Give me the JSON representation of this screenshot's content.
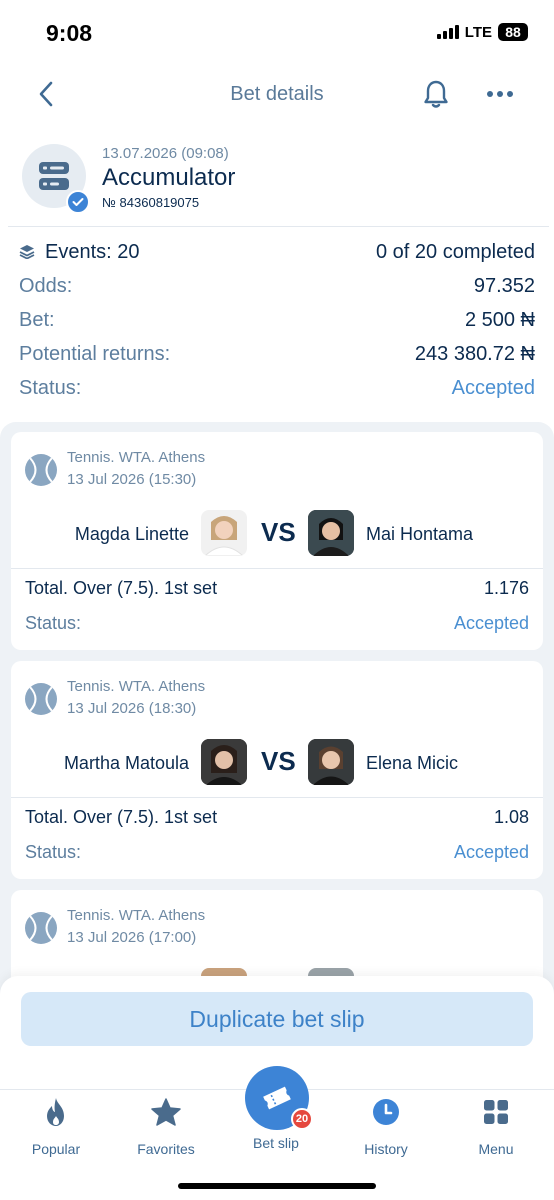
{
  "status_bar": {
    "time": "9:08",
    "network": "LTE",
    "battery": "88"
  },
  "header": {
    "title": "Bet details",
    "back_icon": "chevron-left-icon",
    "bell_icon": "bell-icon",
    "more_icon": "more-dots-icon"
  },
  "bet": {
    "date": "13.07.2026 (09:08)",
    "type": "Accumulator",
    "number": "№ 84360819075"
  },
  "summary": {
    "events_label": "Events: 20",
    "completed": "0 of 20 completed",
    "odds_label": "Odds:",
    "odds_value": "97.352",
    "bet_label": "Bet:",
    "bet_value": "2 500 ₦",
    "returns_label": "Potential returns:",
    "returns_value": "243 380.72 ₦",
    "status_label": "Status:",
    "status_value": "Accepted"
  },
  "events": [
    {
      "league": "Tennis. WTA. Athens",
      "date": "13 Jul 2026 (15:30)",
      "player1": "Magda Linette",
      "player2": "Mai Hontama",
      "vs": "VS",
      "market": "Total. Over (7.5). 1st set",
      "odds": "1.176",
      "status_label": "Status:",
      "status": "Accepted"
    },
    {
      "league": "Tennis. WTA. Athens",
      "date": "13 Jul 2026 (18:30)",
      "player1": "Martha Matoula",
      "player2": "Elena Micic",
      "vs": "VS",
      "market": "Total. Over (7.5). 1st set",
      "odds": "1.08",
      "status_label": "Status:",
      "status": "Accepted"
    },
    {
      "league": "Tennis. WTA. Athens",
      "date": "13 Jul 2026 (17:00)"
    }
  ],
  "actions": {
    "duplicate": "Duplicate bet slip"
  },
  "nav": {
    "popular": "Popular",
    "favorites": "Favorites",
    "bet_slip": "Bet slip",
    "bet_slip_count": "20",
    "history": "History",
    "menu": "Menu"
  },
  "colors": {
    "accent": "#3d84d6",
    "accepted": "#4a8fd1",
    "badge": "#e5483e",
    "button_bg": "#d6e8f8"
  }
}
